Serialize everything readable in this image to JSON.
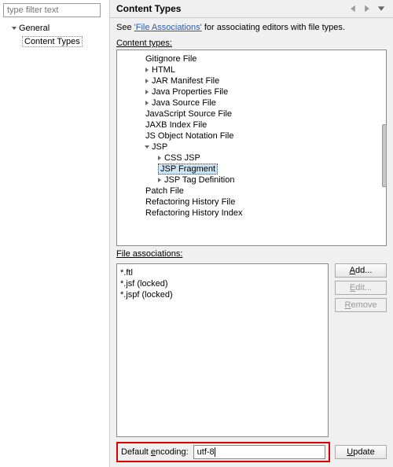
{
  "filter_placeholder": "type filter text",
  "left_tree": {
    "root": "General",
    "child": "Content Types"
  },
  "header": {
    "title": "Content Types"
  },
  "intro": {
    "prefix": "See ",
    "link": "'File Associations'",
    "suffix": " for associating editors with file types."
  },
  "labels": {
    "content_types": "Content types:",
    "file_assoc": "File associations:",
    "encoding": "Default encoding:"
  },
  "content_tree": [
    {
      "depth": 1,
      "caret": "",
      "label": "Gitignore File"
    },
    {
      "depth": 1,
      "caret": "closed",
      "label": "HTML"
    },
    {
      "depth": 1,
      "caret": "closed",
      "label": "JAR Manifest File"
    },
    {
      "depth": 1,
      "caret": "closed",
      "label": "Java Properties File"
    },
    {
      "depth": 1,
      "caret": "closed",
      "label": "Java Source File"
    },
    {
      "depth": 1,
      "caret": "",
      "label": "JavaScript Source File"
    },
    {
      "depth": 1,
      "caret": "",
      "label": "JAXB Index File"
    },
    {
      "depth": 1,
      "caret": "",
      "label": "JS Object Notation File"
    },
    {
      "depth": 1,
      "caret": "open",
      "label": "JSP"
    },
    {
      "depth": 2,
      "caret": "closed",
      "label": "CSS JSP"
    },
    {
      "depth": 2,
      "caret": "",
      "label": "JSP Fragment",
      "selected": true
    },
    {
      "depth": 2,
      "caret": "closed",
      "label": "JSP Tag Definition"
    },
    {
      "depth": 1,
      "caret": "",
      "label": "Patch File"
    },
    {
      "depth": 1,
      "caret": "",
      "label": "Refactoring History File"
    },
    {
      "depth": 1,
      "caret": "",
      "label": "Refactoring History Index"
    }
  ],
  "file_associations": [
    "*.ftl",
    "*.jsf (locked)",
    "*.jspf (locked)"
  ],
  "buttons": {
    "add": "Add...",
    "edit": "Edit...",
    "remove": "Remove",
    "update": "Update"
  },
  "encoding_value": "utf-8"
}
